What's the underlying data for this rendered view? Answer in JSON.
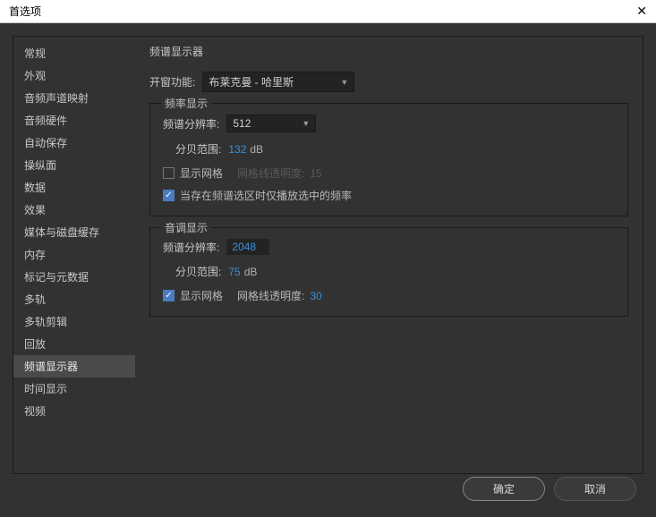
{
  "titlebar": {
    "title": "首选项"
  },
  "sidebar": {
    "items": [
      {
        "label": "常规"
      },
      {
        "label": "外观"
      },
      {
        "label": "音频声道映射"
      },
      {
        "label": "音频硬件"
      },
      {
        "label": "自动保存"
      },
      {
        "label": "操纵面"
      },
      {
        "label": "数据"
      },
      {
        "label": "效果"
      },
      {
        "label": "媒体与磁盘缓存"
      },
      {
        "label": "内存"
      },
      {
        "label": "标记与元数据"
      },
      {
        "label": "多轨"
      },
      {
        "label": "多轨剪辑"
      },
      {
        "label": "回放"
      },
      {
        "label": "频谱显示器"
      },
      {
        "label": "时间显示"
      },
      {
        "label": "视频"
      }
    ]
  },
  "content": {
    "heading": "频谱显示器",
    "window_function": {
      "label": "开窗功能:",
      "value": "布莱克曼 - 哈里斯"
    },
    "freq_group": {
      "title": "频率显示",
      "resolution_label": "频谱分辨率:",
      "resolution_value": "512",
      "db_label": "分贝范围:",
      "db_value": "132",
      "db_unit": "dB",
      "show_grid": "显示网格",
      "grid_opacity_label": "网格线透明度:",
      "grid_opacity_value": "15",
      "only_selection": "当存在频谱选区时仅播放选中的频率"
    },
    "pitch_group": {
      "title": "音调显示",
      "resolution_label": "频谱分辨率:",
      "resolution_value": "2048",
      "db_label": "分贝范围:",
      "db_value": "75",
      "db_unit": "dB",
      "show_grid": "显示网格",
      "grid_opacity_label": "网格线透明度:",
      "grid_opacity_value": "30"
    }
  },
  "footer": {
    "ok": "确定",
    "cancel": "取消"
  }
}
